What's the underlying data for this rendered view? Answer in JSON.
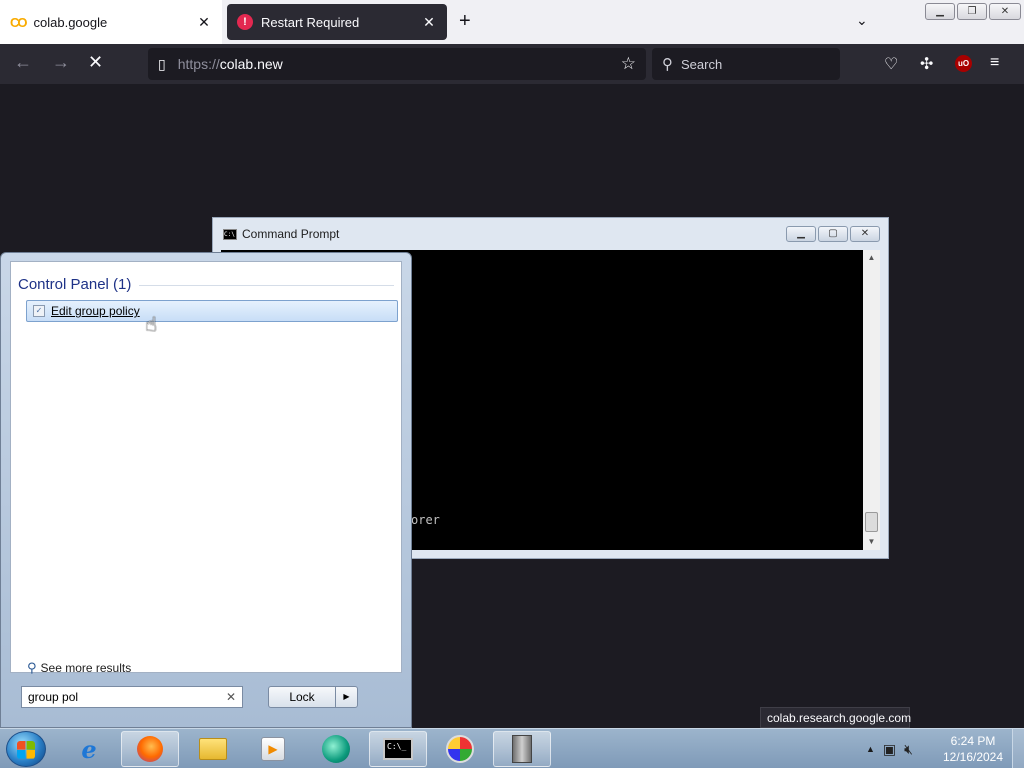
{
  "browser": {
    "tabs": [
      {
        "title": "colab.google",
        "icon": "colab-logo-icon"
      },
      {
        "title": "Restart Required",
        "icon": "warning-icon"
      }
    ],
    "url_protocol": "https://",
    "url_host": "colab.new",
    "search_placeholder": "Search",
    "status_url": "colab.research.google.com"
  },
  "cmd_window": {
    "title": "Command Prompt",
    "visible_text": "orer"
  },
  "start_menu": {
    "group_header": "Control Panel (1)",
    "result": "Edit group policy",
    "see_more": "See more results",
    "search_value": "group pol",
    "lock_label": "Lock"
  },
  "taskbar": {
    "clock_time": "6:24 PM",
    "clock_date": "12/16/2024"
  },
  "colors": {
    "browser_dark": "#2b2a33",
    "page_bg": "#1c1b22",
    "warning_red": "#e22850",
    "taskbar_blue": "#8aa4c0"
  }
}
